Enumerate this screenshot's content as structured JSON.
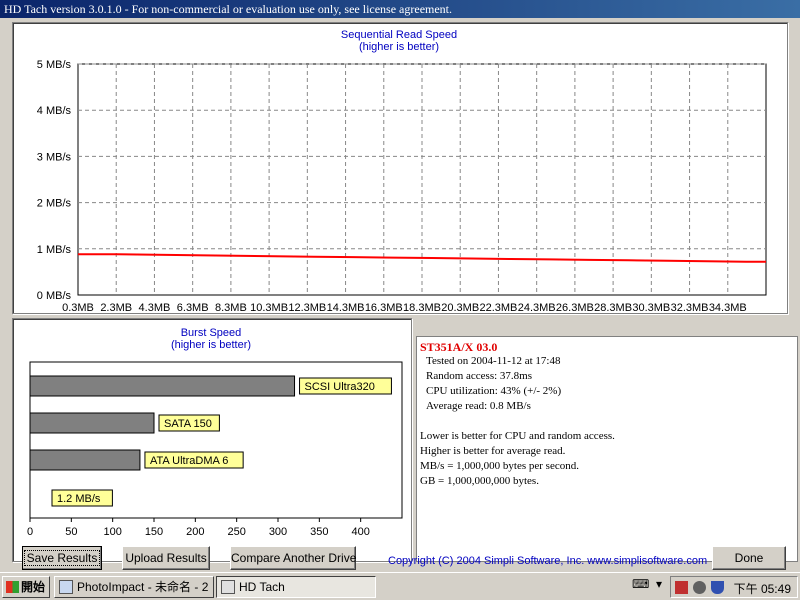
{
  "window": {
    "title": "HD Tach version 3.0.1.0  - For non-commercial or evaluation use only, see license agreement."
  },
  "sequential_chart": {
    "title_line1": "Sequential Read Speed",
    "title_line2": "(higher is better)",
    "y_ticks": [
      "5 MB/s",
      "4 MB/s",
      "3 MB/s",
      "2 MB/s",
      "1 MB/s",
      "0 MB/s"
    ],
    "x_ticks": [
      "0.3MB",
      "2.3MB",
      "4.3MB",
      "6.3MB",
      "8.3MB",
      "10.3MB",
      "12.3MB",
      "14.3MB",
      "16.3MB",
      "18.3MB",
      "20.3MB",
      "22.3MB",
      "24.3MB",
      "26.3MB",
      "28.3MB",
      "30.3MB",
      "32.3MB",
      "34.3MB"
    ],
    "line_color": "#ff0000"
  },
  "burst_chart": {
    "title_line1": "Burst Speed",
    "title_line2": "(higher is better)",
    "x_ticks": [
      "0",
      "50",
      "100",
      "150",
      "200",
      "250",
      "300",
      "350",
      "400"
    ],
    "label_bg": "#ffff99",
    "bar_color": "#808080"
  },
  "chart_data": [
    {
      "type": "line",
      "title": "Sequential Read Speed",
      "subtitle": "(higher is better)",
      "xlabel": "",
      "ylabel": "",
      "x_unit": "MB",
      "y_unit": "MB/s",
      "xlim": [
        0.3,
        35.3
      ],
      "ylim": [
        0,
        5
      ],
      "grid": true,
      "series": [
        {
          "x": [
            0.3,
            2.3,
            4.3,
            6.3,
            8.3,
            10.3,
            12.3,
            14.3,
            16.3,
            18.3,
            20.3,
            22.3,
            24.3,
            26.3,
            28.3,
            30.3,
            32.3,
            34.3,
            35.3
          ],
          "y": [
            0.88,
            0.88,
            0.87,
            0.86,
            0.85,
            0.84,
            0.83,
            0.82,
            0.81,
            0.8,
            0.79,
            0.78,
            0.77,
            0.76,
            0.75,
            0.74,
            0.73,
            0.72,
            0.72
          ]
        }
      ]
    },
    {
      "type": "bar",
      "orientation": "horizontal",
      "title": "Burst Speed",
      "subtitle": "(higher is better)",
      "xlim": [
        0,
        450
      ],
      "grid": false,
      "categories": [
        "SCSI Ultra320",
        "SATA 150",
        "ATA UltraDMA 6",
        "1.2 MB/s"
      ],
      "values": [
        320,
        150,
        133,
        1.2
      ]
    }
  ],
  "info": {
    "drive_name": "ST351A/X 03.0",
    "tested_on": "Tested on 2004-11-12 at 17:48",
    "random_access": "Random access: 37.8ms",
    "cpu_utilization": "CPU utilization: 43% (+/- 2%)",
    "average_read": "Average read: 0.8 MB/s",
    "note1": "Lower is better for CPU and random access.",
    "note2": "Higher is better for average read.",
    "note3": "MB/s = 1,000,000 bytes per second.",
    "note4": "GB = 1,000,000,000 bytes."
  },
  "buttons": {
    "save": "Save Results",
    "upload": "Upload Results",
    "compare": "Compare Another Drive",
    "done": "Done"
  },
  "copyright": "Copyright (C) 2004 Simpli Software, Inc. www.simplisoftware.com",
  "taskbar": {
    "start": "開始",
    "task1": "PhotoImpact - 未命名 - 2",
    "task2": "HD Tach",
    "clock": "下午 05:49"
  }
}
